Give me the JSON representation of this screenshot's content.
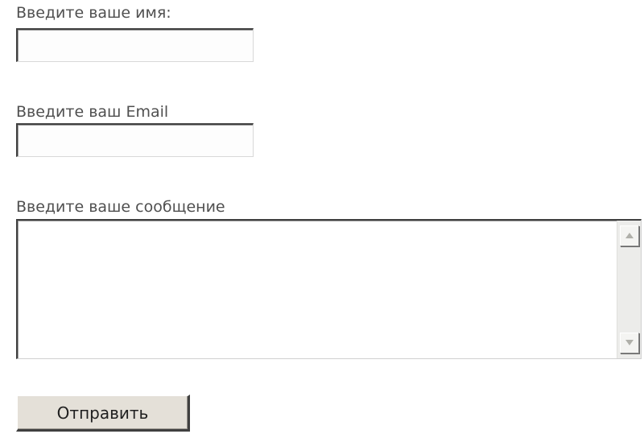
{
  "form": {
    "name_label": "Введите ваше имя:",
    "name_value": "",
    "email_label": "Введите ваш Email",
    "email_value": "",
    "message_label": "Введите ваше сообщение",
    "message_value": "",
    "submit_label": "Отправить"
  },
  "icons": {
    "scroll_up": "scroll-up-arrow-icon",
    "scroll_down": "scroll-down-arrow-icon"
  },
  "colors": {
    "label_text": "#505050",
    "button_face": "#e4e0d8",
    "scrollbar_track": "#ececea"
  }
}
